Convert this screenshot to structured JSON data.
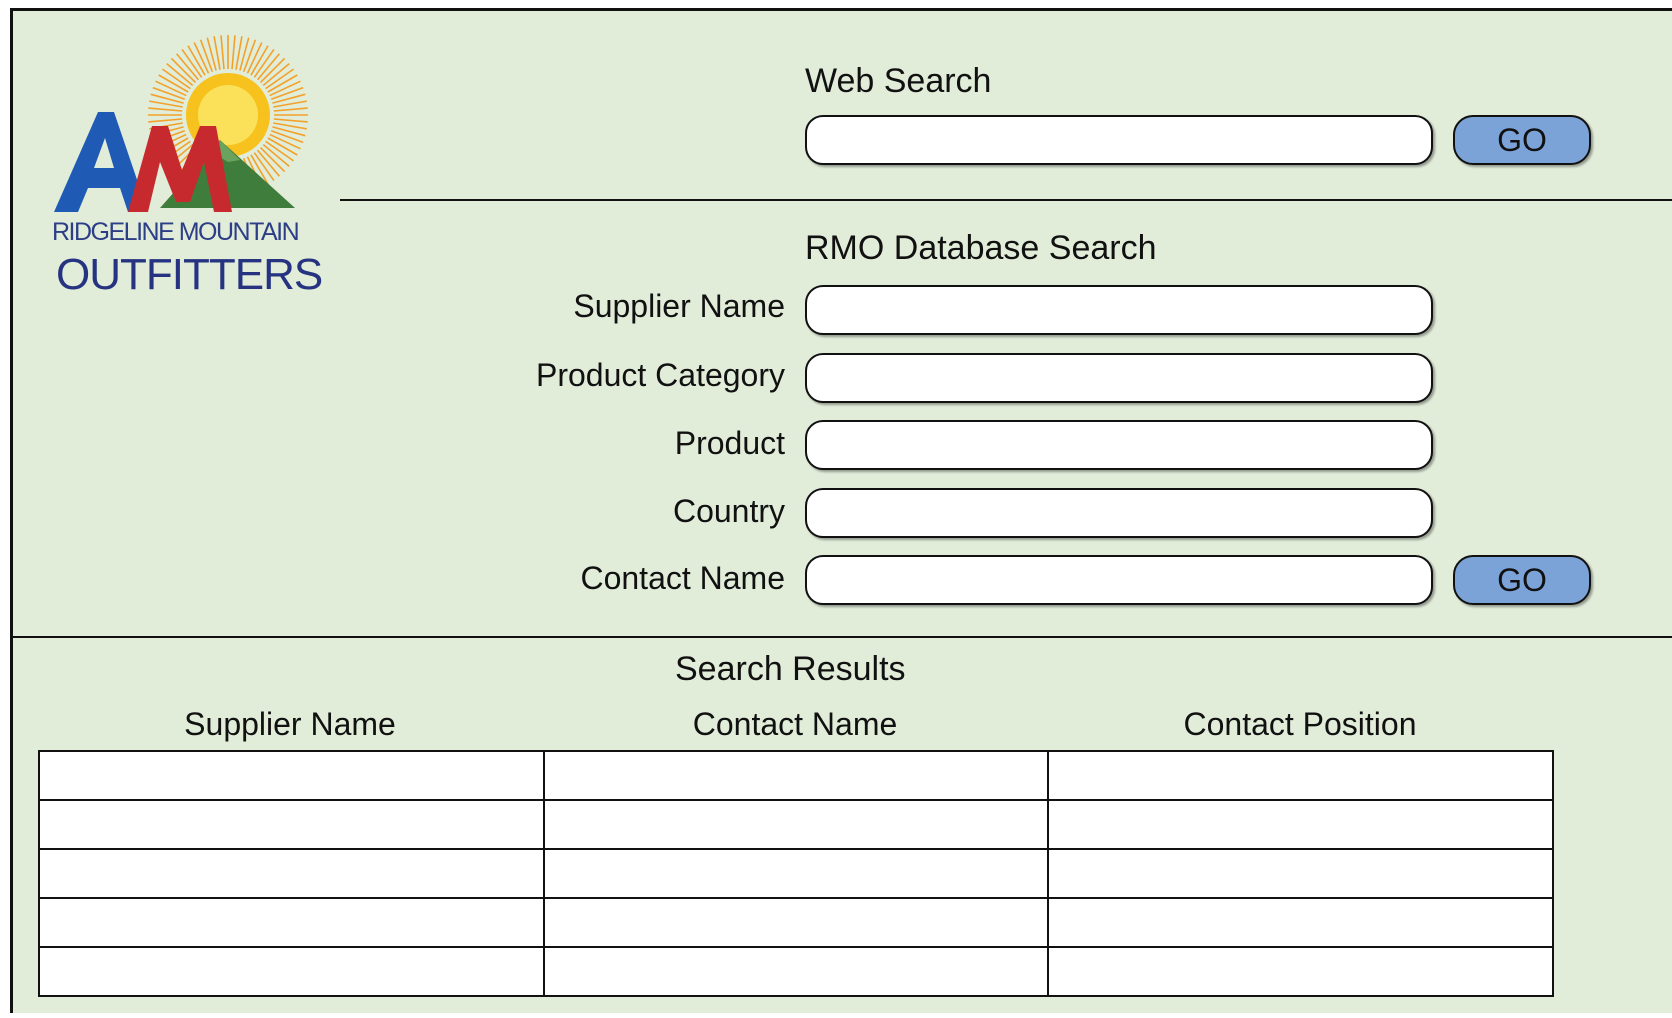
{
  "logo": {
    "line1": "RIDGELINE MOUNTAIN",
    "line2": "OUTFITTERS",
    "colors": {
      "sun": "#f7c21d",
      "blue": "#1f5bb5",
      "red": "#c62a2f",
      "green": "#3f7d3c",
      "navy": "#253381"
    }
  },
  "web_search": {
    "title": "Web Search",
    "input_value": "",
    "go_label": "GO"
  },
  "db_search": {
    "title": "RMO Database Search",
    "fields": [
      {
        "label": "Supplier Name",
        "value": ""
      },
      {
        "label": "Product Category",
        "value": ""
      },
      {
        "label": "Product",
        "value": ""
      },
      {
        "label": "Country",
        "value": ""
      },
      {
        "label": "Contact Name",
        "value": ""
      }
    ],
    "go_label": "GO"
  },
  "results": {
    "title": "Search Results",
    "columns": [
      "Supplier Name",
      "Contact Name",
      "Contact Position"
    ],
    "rows": [
      [
        "",
        "",
        ""
      ],
      [
        "",
        "",
        ""
      ],
      [
        "",
        "",
        ""
      ],
      [
        "",
        "",
        ""
      ],
      [
        "",
        "",
        ""
      ]
    ]
  },
  "colors": {
    "panel_bg": "#e1ecd9",
    "button_bg": "#7ca3d8"
  }
}
